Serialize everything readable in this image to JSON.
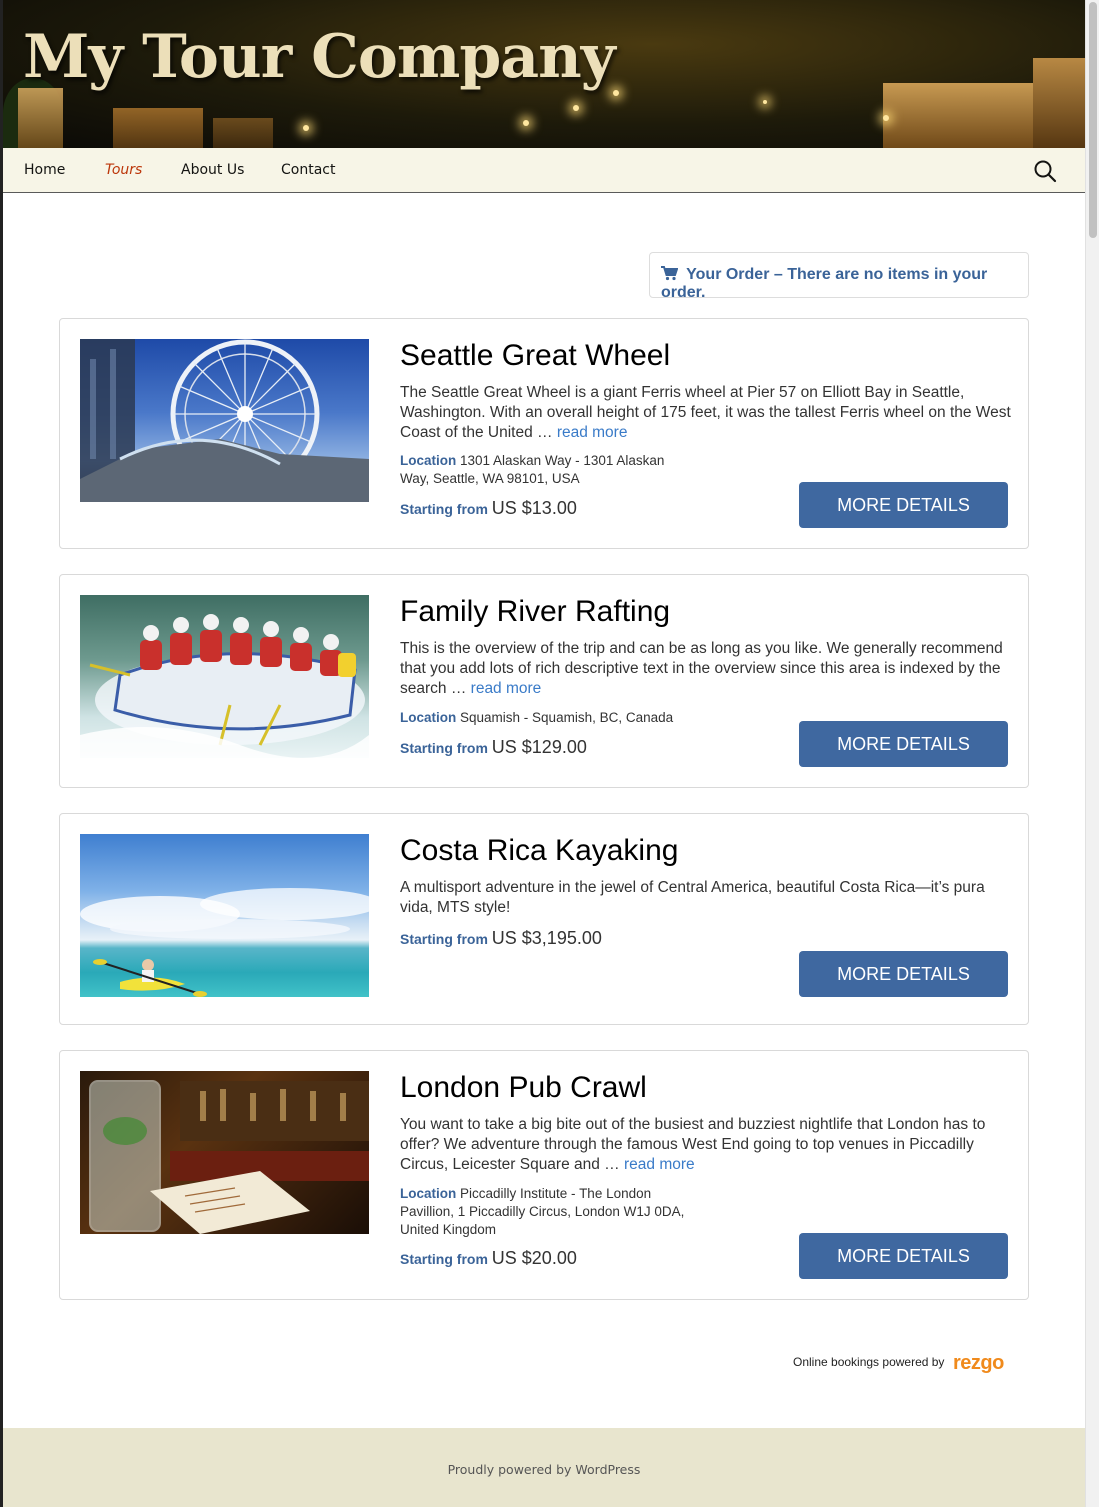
{
  "site": {
    "title": "My Tour Company"
  },
  "nav": {
    "items": [
      "Home",
      "Tours",
      "About Us",
      "Contact"
    ],
    "active": "Tours"
  },
  "order": {
    "label": "Your Order – There are no items in your order."
  },
  "labels": {
    "location": "Location",
    "starting_from": "Starting from",
    "read_more": "read more",
    "button": "MORE DETAILS"
  },
  "tours": [
    {
      "name": "Seattle Great Wheel",
      "description": "The Seattle Great Wheel is a giant Ferris wheel at Pier 57 on Elliott Bay in Seattle, Washington. With an overall height of 175 feet, it was the tallest Ferris wheel on the West Coast of the United …",
      "location": "1301 Alaskan Way - 1301 Alaskan Way, Seattle, WA 98101, USA",
      "price": "US $13.00"
    },
    {
      "name": "Family River Rafting",
      "description": "This is the overview of the trip and can be as long as you like.  We generally recommend that you add lots of rich descriptive text in the overview since this area is indexed by the search …",
      "location": "Squamish - Squamish, BC, Canada",
      "price": "US $129.00"
    },
    {
      "name": "Costa Rica Kayaking",
      "description": "A multisport adventure in the jewel of Central America, beautiful Costa Rica—it’s pura vida, MTS style!",
      "price": "US $3,195.00"
    },
    {
      "name": "London Pub Crawl",
      "description": "You want to take a big bite out of the busiest and buzziest nightlife that London has to offer? We adventure through the famous West End going to top venues in Piccadilly Circus, Leicester Square and …",
      "location": "Piccadilly Institute - The London Pavillion, 1 Piccadilly Circus, London W1J 0DA, United Kingdom",
      "price": "US $20.00"
    }
  ],
  "powered_by": {
    "label": "Online bookings powered by",
    "brand": "rezgo"
  },
  "footer": {
    "text": "Proudly powered by WordPress"
  },
  "colors": {
    "accent": "#3f68a0",
    "nav_active": "#bc360a",
    "footer_bg": "#e8e5ce",
    "nav_bg": "#f7f5e7"
  }
}
